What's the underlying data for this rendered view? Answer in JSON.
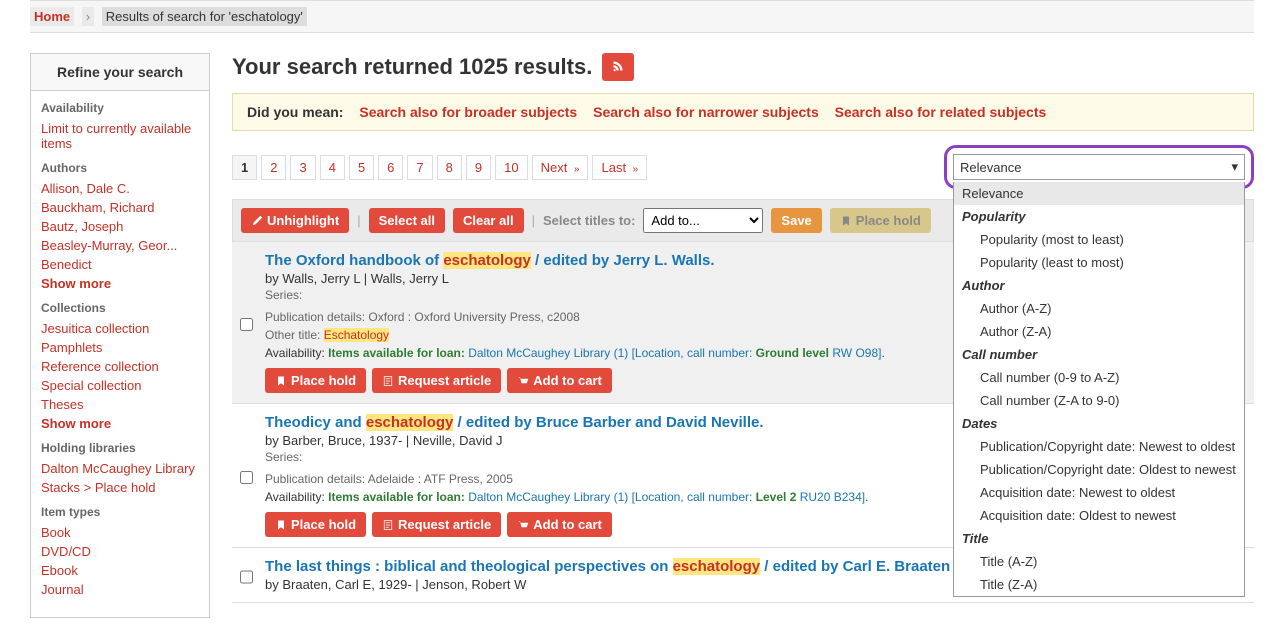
{
  "breadcrumb": {
    "home": "Home",
    "current": "Results of search for 'eschatology'"
  },
  "sidebar": {
    "header": "Refine your search",
    "groups": [
      {
        "title": "Availability",
        "items": [
          "Limit to currently available items"
        ]
      },
      {
        "title": "Authors",
        "items": [
          "Allison, Dale C.",
          "Bauckham, Richard",
          "Bautz, Joseph",
          "Beasley-Murray, Geor...",
          "Benedict"
        ],
        "show_more": "Show more"
      },
      {
        "title": "Collections",
        "items": [
          "Jesuitica collection",
          "Pamphlets",
          "Reference collection",
          "Special collection",
          "Theses"
        ],
        "show_more": "Show more"
      },
      {
        "title": "Holding libraries",
        "items": [
          "Dalton McCaughey Library",
          "Stacks > Place hold"
        ]
      },
      {
        "title": "Item types",
        "items": [
          "Book",
          "DVD/CD",
          "Ebook",
          "Journal"
        ]
      }
    ]
  },
  "heading": "Your search returned 1025 results.",
  "didyoumean": {
    "label": "Did you mean:",
    "links": [
      "Search also for broader subjects",
      "Search also for narrower subjects",
      "Search also for related subjects"
    ]
  },
  "pagination": {
    "pages": [
      "1",
      "2",
      "3",
      "4",
      "5",
      "6",
      "7",
      "8",
      "9",
      "10"
    ],
    "next": "Next",
    "last": "Last"
  },
  "sort": {
    "selected": "Relevance",
    "structure": [
      {
        "type": "opt",
        "label": "Relevance",
        "selected": true
      },
      {
        "type": "group",
        "label": "Popularity"
      },
      {
        "type": "optindent",
        "label": "Popularity (most to least)"
      },
      {
        "type": "optindent",
        "label": "Popularity (least to most)"
      },
      {
        "type": "group",
        "label": "Author"
      },
      {
        "type": "optindent",
        "label": "Author (A-Z)"
      },
      {
        "type": "optindent",
        "label": "Author (Z-A)"
      },
      {
        "type": "group",
        "label": "Call number"
      },
      {
        "type": "optindent",
        "label": "Call number (0-9 to A-Z)"
      },
      {
        "type": "optindent",
        "label": "Call number (Z-A to 9-0)"
      },
      {
        "type": "group",
        "label": "Dates"
      },
      {
        "type": "optindent",
        "label": "Publication/Copyright date: Newest to oldest"
      },
      {
        "type": "optindent",
        "label": "Publication/Copyright date: Oldest to newest"
      },
      {
        "type": "optindent",
        "label": "Acquisition date: Newest to oldest"
      },
      {
        "type": "optindent",
        "label": "Acquisition date: Oldest to newest"
      },
      {
        "type": "group",
        "label": "Title"
      },
      {
        "type": "optindent",
        "label": "Title (A-Z)"
      },
      {
        "type": "optindent",
        "label": "Title (Z-A)"
      }
    ]
  },
  "actionbar": {
    "unhighlight": "Unhighlight",
    "select_all": "Select all",
    "clear_all": "Clear all",
    "select_titles_to": "Select titles to:",
    "add_to": "Add to...",
    "save": "Save",
    "place_hold": "Place hold"
  },
  "results": [
    {
      "title_pre": "The Oxford handbook of ",
      "title_hl": "eschatology",
      "title_post": " / edited by Jerry L. Walls.",
      "by": "by Walls, Jerry L |  Walls, Jerry L",
      "series": "Series:",
      "pub_label": "Publication details: ",
      "pub_value": "Oxford : Oxford University Press, c2008",
      "other_label": "Other title: ",
      "other_value": "Eschatology",
      "avail_label": "Availability: ",
      "avail_green": "Items available for loan: ",
      "avail_lib": "Dalton McCaughey Library (1) ",
      "avail_loc_label": "[Location, call number: ",
      "avail_loc_bold": "Ground level ",
      "avail_loc_rest": "RW O98]",
      "place_hold": "Place hold",
      "request": "Request article",
      "add_cart": "Add to cart",
      "has_other": true,
      "first": true
    },
    {
      "title_pre": "Theodicy and ",
      "title_hl": "eschatology",
      "title_post": " / edited by Bruce Barber and David Neville.",
      "by": "by Barber, Bruce, 1937- |  Neville, David J",
      "series": "Series:",
      "pub_label": "Publication details: ",
      "pub_value": "Adelaide : ATF Press, 2005",
      "other_label": "",
      "other_value": "",
      "avail_label": "Availability: ",
      "avail_green": "Items available for loan: ",
      "avail_lib": "Dalton McCaughey Library (1) ",
      "avail_loc_label": "[Location, call number: ",
      "avail_loc_bold": "Level 2 ",
      "avail_loc_rest": "RU20 B234]",
      "place_hold": "Place hold",
      "request": "Request article",
      "add_cart": "Add to cart",
      "has_other": false,
      "first": false
    },
    {
      "title_pre": "The last things : biblical and theological perspectives on ",
      "title_hl": "eschatology",
      "title_post": " / edited by Carl E. Braaten and",
      "by": "by Braaten, Carl E, 1929- |  Jenson, Robert W",
      "series": "",
      "pub_label": "",
      "pub_value": "",
      "other_label": "",
      "other_value": "",
      "avail_label": "",
      "avail_green": "",
      "avail_lib": "",
      "avail_loc_label": "",
      "avail_loc_bold": "",
      "avail_loc_rest": "",
      "place_hold": "",
      "request": "",
      "add_cart": "",
      "has_other": false,
      "first": false,
      "truncated": true
    }
  ]
}
